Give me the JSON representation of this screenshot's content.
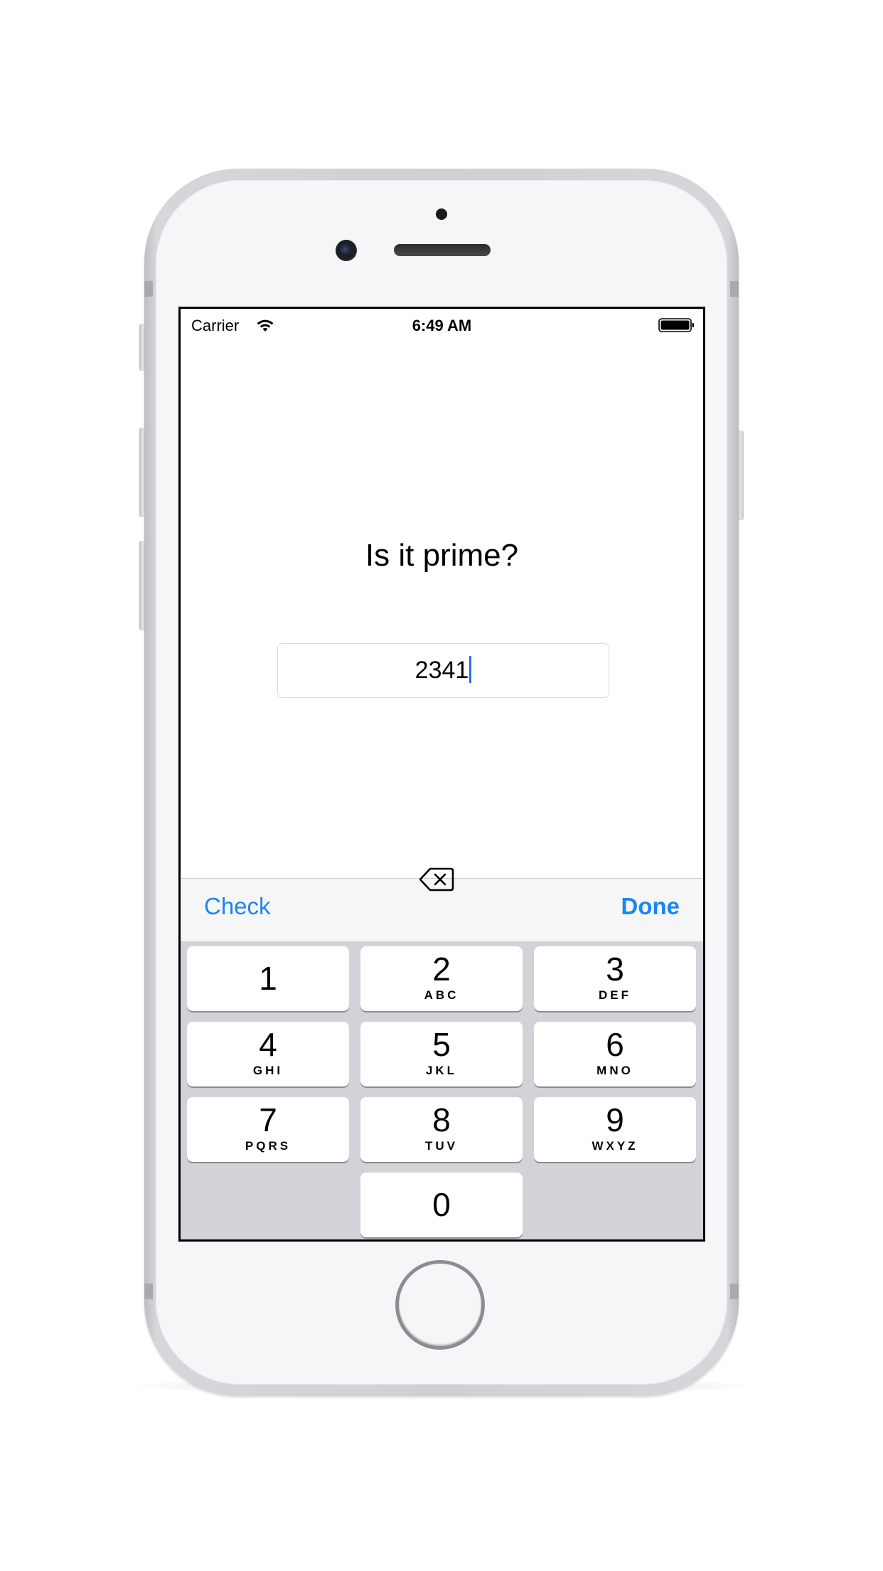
{
  "status_bar": {
    "carrier": "Carrier",
    "time": "6:49 AM",
    "wifi_icon": "wifi-icon",
    "battery_icon": "battery-full-icon"
  },
  "screen": {
    "title": "Is it prime?",
    "number_field": {
      "value": "2341"
    }
  },
  "toolbar": {
    "check_label": "Check",
    "done_label": "Done",
    "accent_color": "#1a86f0"
  },
  "keypad": {
    "keys": [
      {
        "digit": "1",
        "letters": ""
      },
      {
        "digit": "2",
        "letters": "ABC"
      },
      {
        "digit": "3",
        "letters": "DEF"
      },
      {
        "digit": "4",
        "letters": "GHI"
      },
      {
        "digit": "5",
        "letters": "JKL"
      },
      {
        "digit": "6",
        "letters": "MNO"
      },
      {
        "digit": "7",
        "letters": "PQRS"
      },
      {
        "digit": "8",
        "letters": "TUV"
      },
      {
        "digit": "9",
        "letters": "WXYZ"
      },
      {
        "digit": "0",
        "letters": ""
      }
    ],
    "delete_icon": "backspace-icon"
  },
  "device": {
    "model": "iPhone",
    "color": "#d6d7da"
  }
}
